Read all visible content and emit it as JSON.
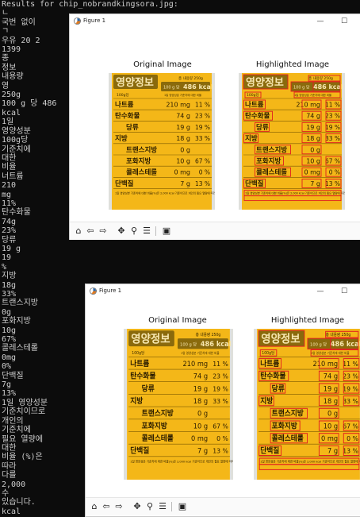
{
  "console": {
    "header": "Results for chip_nobrandkingsora.jpg:",
    "lines": [
      "ㄴ",
      "국번 없이",
      "ㄱ",
      "우유 20 2",
      "1399",
      "종",
      "정보",
      "내용량",
      "영",
      "250g",
      "100 g 당 486",
      "kcal",
      "1일",
      "영양성분",
      "100g당",
      "기준치에",
      "대한",
      "비율",
      "너트륨",
      "210",
      "mg",
      "11%",
      "탄수화물",
      "74g",
      "23%",
      "당류",
      "19 g",
      "19",
      "%",
      "지방",
      "18g",
      "33%",
      "트랜스지방",
      "0g",
      "포화지방",
      "10g",
      "67%",
      "콜레스테롤",
      "0mg",
      "0%",
      "단백질",
      "7g",
      "13%",
      "1일 영양성분",
      "기준치이므로",
      "개인의",
      "기준치에",
      "필요 열량에",
      "대한",
      "비율 (%)은",
      "따라",
      "다를",
      "2,000",
      "수",
      "있습니다.",
      "kcal"
    ]
  },
  "windows": [
    {
      "title": "Figure 1",
      "original_title": "Original Image",
      "highlighted_title": "Highlighted Image"
    },
    {
      "title": "Figure 1",
      "original_title": "Original Image",
      "highlighted_title": "Highlighted Image"
    }
  ],
  "label": {
    "brand": "영양정보",
    "weight": "총 내용량 250g",
    "energy_prefix": "100 g 당",
    "energy": "486 kcal",
    "header_left": "100g당",
    "header_right": "1일 영양성분 기준치에 대한 비율",
    "rows": [
      {
        "name": "나트륨",
        "amount": "210 mg",
        "pct": "11 %"
      },
      {
        "name": "탄수화물",
        "amount": "74 g",
        "pct": "23 %"
      },
      {
        "name": "당류",
        "amount": "19 g",
        "pct": "19 %"
      },
      {
        "name": "지방",
        "amount": "18 g",
        "pct": "33 %"
      },
      {
        "name": "트랜스지방",
        "amount": "0 g",
        "pct": ""
      },
      {
        "name": "포화지방",
        "amount": "10 g",
        "pct": "67 %"
      },
      {
        "name": "콜레스테롤",
        "amount": "0 mg",
        "pct": "0 %"
      },
      {
        "name": "단백질",
        "amount": "7 g",
        "pct": "13 %"
      }
    ],
    "footnote": "1일 영양성분 기준치에 대한 비율(%)은 2,000 kcal 기준이므로 개인의 필요 열량에 따라 다를 수 있습니다."
  },
  "toolbar_icons": [
    "home-icon",
    "back-arrow-icon",
    "forward-arrow-icon",
    "pan-icon",
    "zoom-icon",
    "configure-icon",
    "save-icon"
  ],
  "colors": {
    "console_bg": "#0c0c0c",
    "console_text": "#cfcfcf",
    "label_yellow": "#f4b718",
    "label_dark": "#8a6a0c",
    "highlight_red": "#e02020"
  }
}
